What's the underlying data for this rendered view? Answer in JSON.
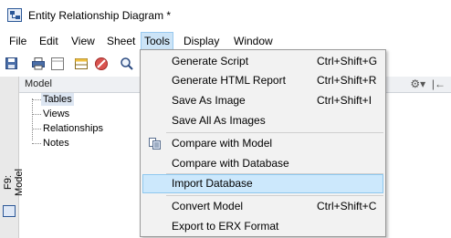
{
  "window": {
    "title": "Entity Relationship Diagram *"
  },
  "menubar": {
    "items": [
      {
        "label": "File"
      },
      {
        "label": "Edit"
      },
      {
        "label": "View"
      },
      {
        "label": "Sheet"
      },
      {
        "label": "Tools"
      },
      {
        "label": "Display"
      },
      {
        "label": "Window"
      }
    ],
    "active": "Tools"
  },
  "side_tab": {
    "label": "F9: Model"
  },
  "panel": {
    "title": "Model",
    "tree": [
      {
        "label": "Tables",
        "selected": true
      },
      {
        "label": "Views"
      },
      {
        "label": "Relationships"
      },
      {
        "label": "Notes"
      }
    ]
  },
  "tools_menu": {
    "items": [
      {
        "label": "Generate Script",
        "shortcut": "Ctrl+Shift+G"
      },
      {
        "label": "Generate HTML Report",
        "shortcut": "Ctrl+Shift+R"
      },
      {
        "label": "Save As Image",
        "shortcut": "Ctrl+Shift+I"
      },
      {
        "label": "Save All As Images",
        "shortcut": ""
      },
      {
        "label": "Compare with Model",
        "shortcut": "",
        "icon": "compare-icon"
      },
      {
        "label": "Compare with Database",
        "shortcut": ""
      },
      {
        "label": "Import Database",
        "shortcut": "",
        "highlighted": true
      },
      {
        "label": "Convert Model",
        "shortcut": "Ctrl+Shift+C"
      },
      {
        "label": "Export to ERX Format",
        "shortcut": ""
      }
    ]
  },
  "colors": {
    "menu_active_bg": "#cce4f7",
    "menu_hover_bg": "#cce8fc",
    "accent": "#2b5797"
  }
}
